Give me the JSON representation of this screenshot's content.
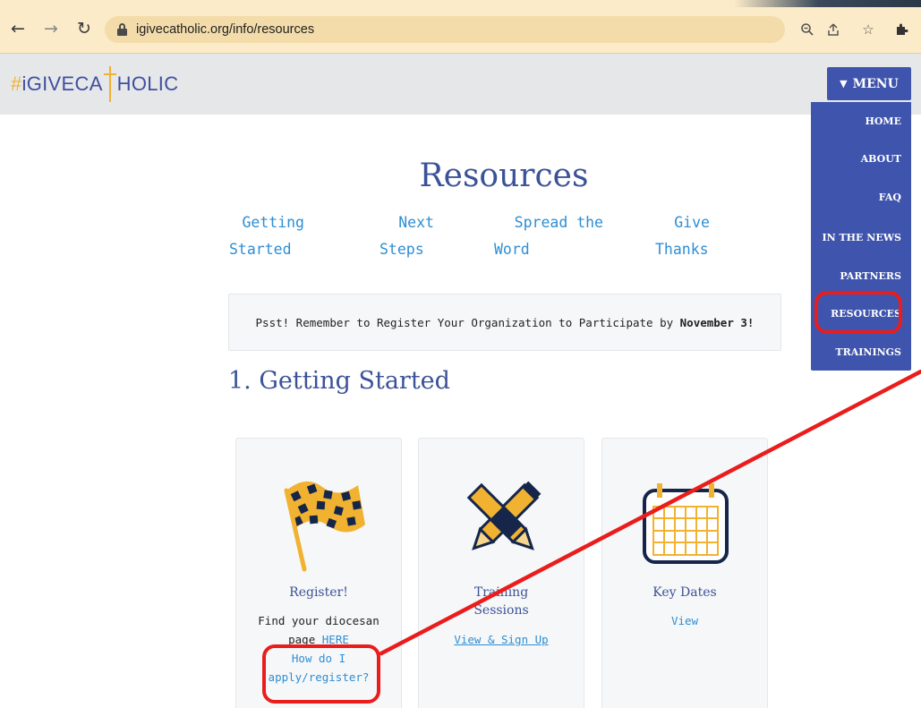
{
  "browser": {
    "url": "igivecatholic.org/info/resources",
    "icons": [
      "back-arrow-icon",
      "forward-arrow-icon",
      "reload-icon",
      "lock-icon",
      "zoom-icon",
      "share-icon",
      "star-icon",
      "extensions-icon"
    ]
  },
  "header": {
    "logo_hash": "#",
    "logo_text_left": "iGIVECA",
    "logo_text_right": "HOLIC",
    "menu_label": "MENU"
  },
  "menu": {
    "items": [
      {
        "label": "HOME"
      },
      {
        "label": "ABOUT"
      },
      {
        "label": "FAQ"
      },
      {
        "label": "IN THE NEWS"
      },
      {
        "label": "PARTNERS"
      },
      {
        "label": "RESOURCES"
      },
      {
        "label": "TRAININGS"
      }
    ]
  },
  "page": {
    "title": "Resources",
    "subnav": [
      {
        "line1": "Getting",
        "line2": "Started"
      },
      {
        "line1": "Next",
        "line2": "Steps"
      },
      {
        "line1": "Spread the",
        "line2": "Word"
      },
      {
        "line1": "Give",
        "line2": "Thanks"
      }
    ],
    "notice_text": "Psst! Remember to Register Your Organization to Participate by ",
    "notice_bold": "November 3!",
    "section_heading": "1. Getting Started"
  },
  "cards": [
    {
      "title": "Register!",
      "text_line1": "Find your diocesan",
      "text_line2_prefix": "page ",
      "text_line2_link": "HERE",
      "link_line1": "How do I",
      "link_line2": "apply/register?",
      "icon": "checkered-flag-icon"
    },
    {
      "title_line1": "Training",
      "title_line2": "Sessions",
      "link": "View & Sign Up",
      "icon": "crossed-pencils-icon"
    },
    {
      "title": "Key Dates",
      "link": "View",
      "icon": "calendar-icon"
    }
  ],
  "colors": {
    "brand_blue": "#3f55ad",
    "title_blue": "#3b5298",
    "link_blue": "#2e8ed4",
    "gold": "#f2b231",
    "navy": "#15264a",
    "annotation_red": "#ea1c1c",
    "browser_bar": "#fcebc9"
  }
}
